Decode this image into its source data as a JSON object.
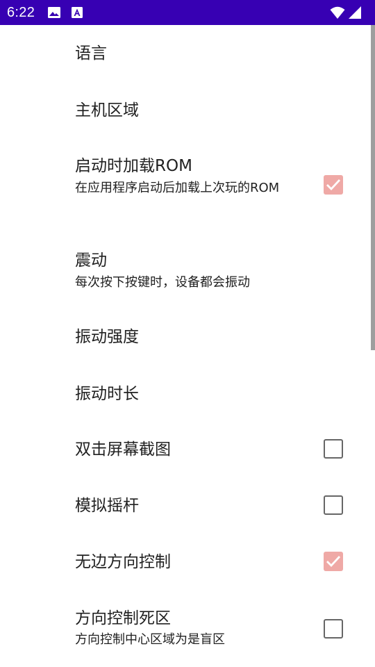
{
  "status_bar": {
    "time": "6:22",
    "icons": [
      "image-icon",
      "accessibility-icon",
      "wifi-icon",
      "cellular-signal-icon"
    ],
    "background": "#3700b3"
  },
  "settings": [
    {
      "title": "语言"
    },
    {
      "title": "主机区域"
    },
    {
      "title": "启动时加载ROM",
      "summary": "在应用程序启动后加载上次玩的ROM",
      "checked": true
    },
    {
      "title": "震动",
      "summary": "每次按下按键时，设备都会振动"
    },
    {
      "title": "振动强度"
    },
    {
      "title": "振动时长"
    },
    {
      "title": "双击屏幕截图",
      "checked": false
    },
    {
      "title": "模拟摇杆",
      "checked": false
    },
    {
      "title": "无边方向控制",
      "checked": true
    },
    {
      "title": "方向控制死区",
      "summary": "方向控制中心区域为是盲区",
      "checked": false
    }
  ],
  "colors": {
    "checkbox_checked": "#efa9a6",
    "checkbox_border": "#666666",
    "text": "#212121"
  }
}
